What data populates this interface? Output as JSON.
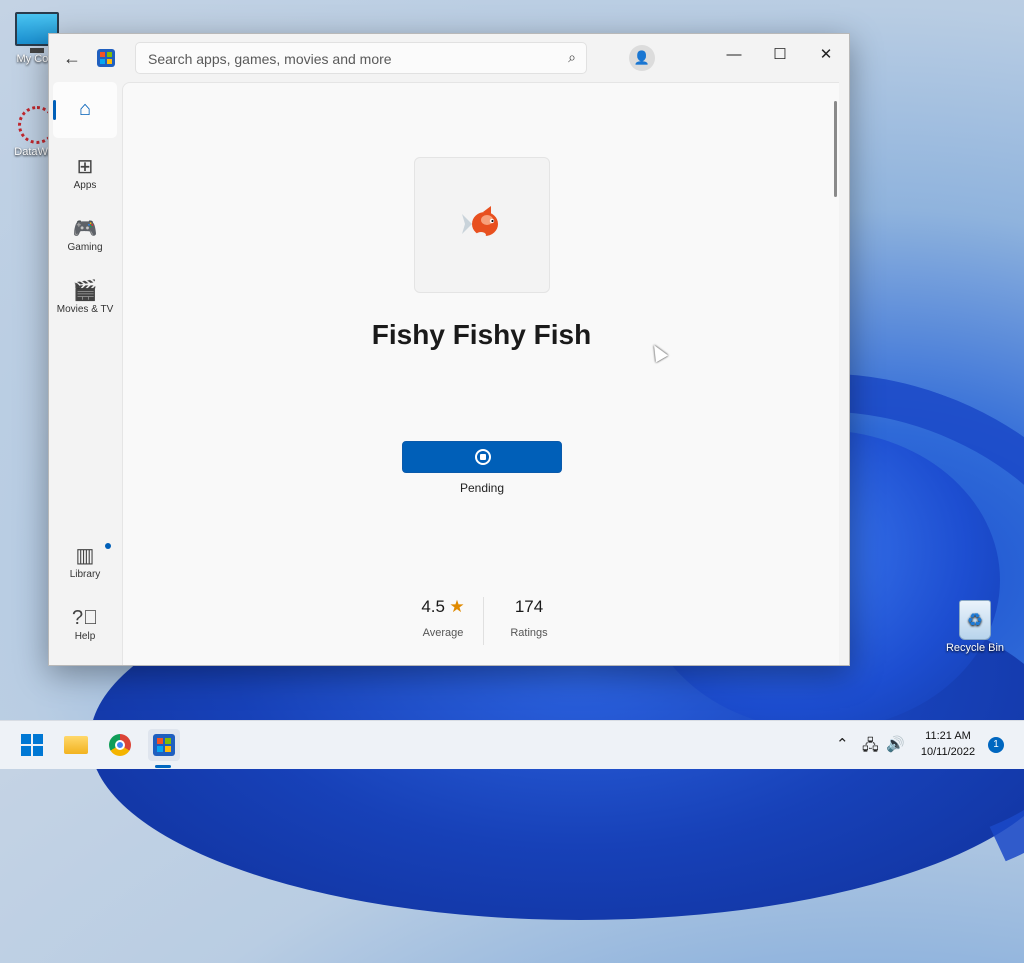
{
  "desktop": {
    "icons": [
      {
        "label": "My Com"
      },
      {
        "label": "DataWag"
      },
      {
        "label": "Recycle Bin"
      }
    ]
  },
  "window": {
    "search": {
      "placeholder": "Search apps, games, movies and more"
    },
    "controls": {
      "minimize": "—",
      "maximize": "☐",
      "close": "✕"
    }
  },
  "nav": {
    "items": [
      {
        "label": "Apps"
      },
      {
        "label": "Gaming"
      },
      {
        "label": "Movies & TV"
      },
      {
        "label": "Library"
      },
      {
        "label": "Help"
      }
    ]
  },
  "app": {
    "title": "Fishy Fishy Fish",
    "status": "Pending",
    "rating": "4.5",
    "rating_label": "Average",
    "ratings_count": "174",
    "ratings_label": "Ratings",
    "accent": "#005fb8"
  },
  "taskbar": {
    "time": "11:21 AM",
    "date": "10/11/2022",
    "notification_count": "1"
  }
}
